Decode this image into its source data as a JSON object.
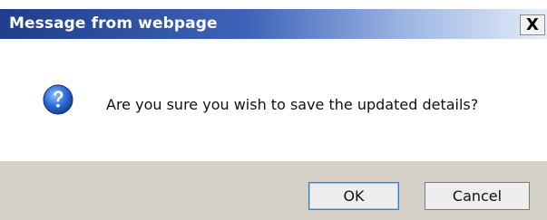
{
  "dialog": {
    "title": "Message from webpage",
    "close_glyph": "X",
    "icon": "question-icon",
    "message": "Are you sure you wish to save the updated details?",
    "buttons": {
      "ok_label": "OK",
      "cancel_label": "Cancel"
    },
    "colors": {
      "titlebar_start": "#1f3e8c",
      "titlebar_end": "#e6edf8",
      "footer_bg": "#d4d0c8",
      "icon_blue": "#2f6bd6"
    }
  }
}
